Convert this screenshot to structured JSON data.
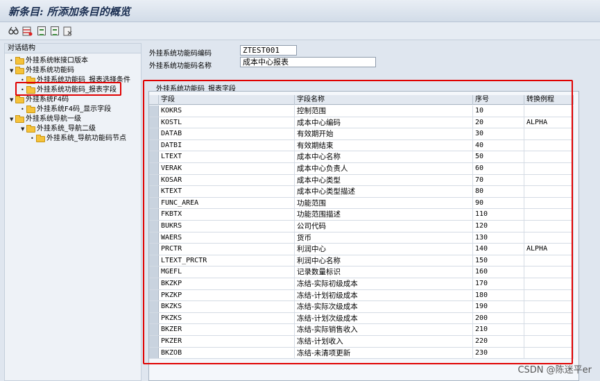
{
  "window": {
    "title": "新条目: 所添加条目的概览"
  },
  "toolbar": {
    "icons": [
      "glasses-icon",
      "table-icon",
      "export-icon",
      "import-icon",
      "delete-icon"
    ]
  },
  "tree": {
    "header": "对话结构",
    "items": [
      {
        "label": "外挂系统帐接口版本",
        "level": 0,
        "kind": "bullet"
      },
      {
        "label": "外挂系统功能码",
        "level": 0,
        "kind": "open"
      },
      {
        "label": "外挂系统功能码_报表选择条件",
        "level": 1,
        "kind": "bullet"
      },
      {
        "label": "外挂系统功能码_报表字段",
        "level": 1,
        "kind": "bullet"
      },
      {
        "label": "外挂系统F4码",
        "level": 0,
        "kind": "open"
      },
      {
        "label": "外挂系统F4码_显示字段",
        "level": 1,
        "kind": "bullet"
      },
      {
        "label": "外挂系统导航一级",
        "level": 0,
        "kind": "open"
      },
      {
        "label": "外挂系统_导航二级",
        "level": 1,
        "kind": "open"
      },
      {
        "label": "外挂系统_导航功能码节点",
        "level": 2,
        "kind": "bullet"
      }
    ]
  },
  "header_fields": {
    "code_label": "外挂系统功能码编码",
    "code_value": "ZTEST001",
    "name_label": "外挂系统功能码名称",
    "name_value": "成本中心报表"
  },
  "table": {
    "group_title": "外挂系统功能码_报表字段",
    "columns": [
      "字段",
      "字段名称",
      "序号",
      "转换例程"
    ],
    "rows": [
      [
        "KOKRS",
        "控制范围",
        "10",
        ""
      ],
      [
        "KOSTL",
        "成本中心编码",
        "20",
        "ALPHA"
      ],
      [
        "DATAB",
        "有效期开始",
        "30",
        ""
      ],
      [
        "DATBI",
        "有效期结束",
        "40",
        ""
      ],
      [
        "LTEXT",
        "成本中心名称",
        "50",
        ""
      ],
      [
        "VERAK",
        "成本中心负责人",
        "60",
        ""
      ],
      [
        "KOSAR",
        "成本中心类型",
        "70",
        ""
      ],
      [
        "KTEXT",
        "成本中心类型描述",
        "80",
        ""
      ],
      [
        "FUNC_AREA",
        "功能范围",
        "90",
        ""
      ],
      [
        "FKBTX",
        "功能范围描述",
        "110",
        ""
      ],
      [
        "BUKRS",
        "公司代码",
        "120",
        ""
      ],
      [
        "WAERS",
        "货币",
        "130",
        ""
      ],
      [
        "PRCTR",
        "利润中心",
        "140",
        "ALPHA"
      ],
      [
        "LTEXT_PRCTR",
        "利润中心名称",
        "150",
        ""
      ],
      [
        "MGEFL",
        "记录数量标识",
        "160",
        ""
      ],
      [
        "BKZKP",
        "冻结-实际初级成本",
        "170",
        ""
      ],
      [
        "PKZKP",
        "冻结-计划初级成本",
        "180",
        ""
      ],
      [
        "BKZKS",
        "冻结-实际次级成本",
        "190",
        ""
      ],
      [
        "PKZKS",
        "冻结-计划次级成本",
        "200",
        ""
      ],
      [
        "BKZER",
        "冻结-实际销售收入",
        "210",
        ""
      ],
      [
        "PKZER",
        "冻结-计划收入",
        "220",
        ""
      ],
      [
        "BKZOB",
        "冻结-未清项更新",
        "230",
        ""
      ]
    ]
  },
  "watermark": "CSDN @陈迷平er",
  "colors": {
    "highlight_box": "#e00000",
    "folder": "#f5c23a"
  }
}
